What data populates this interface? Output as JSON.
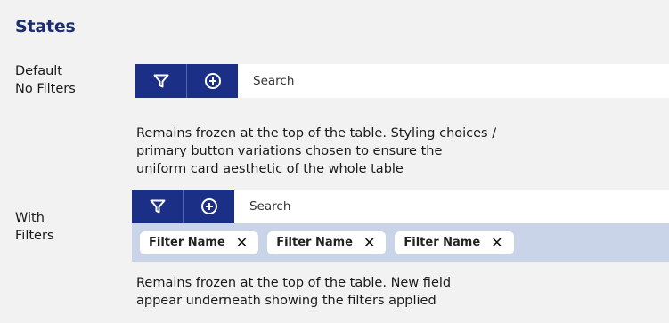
{
  "section_title": "States",
  "states": {
    "default": {
      "label_line1": "Default",
      "label_line2": "No Filters",
      "search_placeholder": "Search",
      "description": [
        "Remains frozen at the top of the table. Styling choices /",
        "primary button variations chosen to ensure the",
        "uniform card aesthetic of the whole table"
      ]
    },
    "with_filters": {
      "label_line1": "With",
      "label_line2": "Filters",
      "search_placeholder": "Search",
      "filter_chips": [
        "Filter Name",
        "Filter Name",
        "Filter Name"
      ],
      "chip_close_glyph": "✕",
      "description": [
        "Remains frozen at the top of the table. New field",
        "appear underneath showing the filters applied"
      ]
    }
  },
  "icons": [
    "filter-icon",
    "add-circle-icon",
    "close-icon"
  ],
  "colors": {
    "primary": "#1b2f87",
    "heading": "#1b2f70",
    "filter_band": "#c9d4e8",
    "background": "#f2f2f2"
  }
}
